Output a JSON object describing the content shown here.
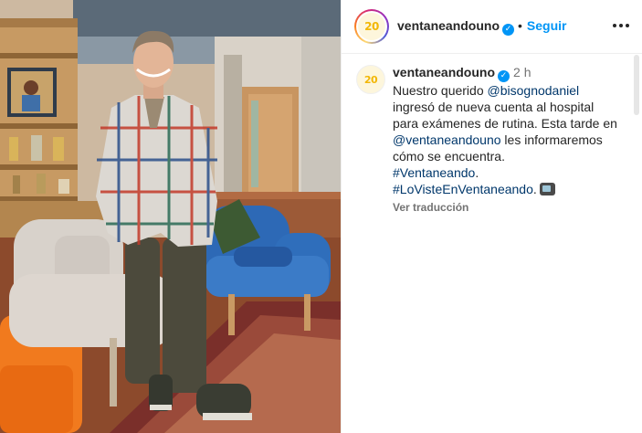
{
  "header": {
    "avatar_logo_text": "20",
    "username": "ventaneandouno",
    "separator": "•",
    "follow_label": "Seguir"
  },
  "caption": {
    "avatar_logo_text": "20",
    "username": "ventaneandouno",
    "time": "2 h",
    "text_parts": {
      "p1": "Nuestro querido ",
      "mention1": "@bisognodaniel",
      "p2": " ingresó de nueva cuenta al hospital para exámenes de rutina. Esta tarde en ",
      "mention2": "@ventaneandouno",
      "p3": " les informaremos cómo se encuentra.",
      "hashtag1": "#Ventaneando",
      "p4": ".",
      "hashtag2": "#LoVisteEnVentaneando",
      "p5": "."
    },
    "emoji_icon": "television-icon",
    "translate_label": "Ver traducción"
  },
  "colors": {
    "link_blue": "#0095f6",
    "mention_blue": "#00376b",
    "muted": "#737373",
    "verified": "#0095f6"
  },
  "icons": {
    "verified": "verified-badge-icon",
    "more": "more-options-icon"
  }
}
